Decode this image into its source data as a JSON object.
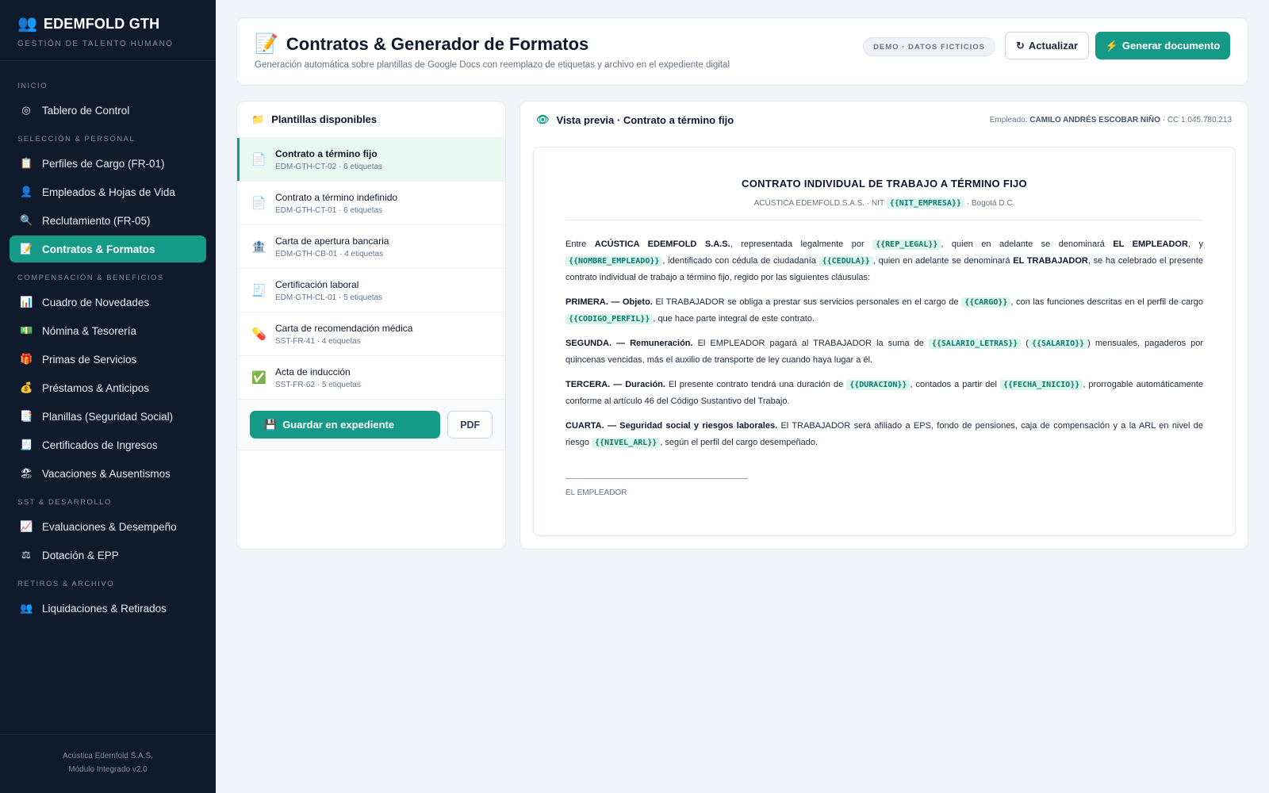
{
  "sidebar": {
    "brand_title": "EDEMFOLD GTH",
    "brand_subtitle": "GESTIÓN DE TALENTO HUMANO",
    "sections": {
      "inicio": "INICIO",
      "seleccion": "SELECCIÓN & PERSONAL",
      "compensacion": "COMPENSACIÓN & BENEFICIOS",
      "sst": "SST & DESARROLLO",
      "retiros": "RETIROS & ARCHIVO"
    },
    "items": {
      "tablero": "Tablero de Control",
      "perfiles": "Perfiles de Cargo (FR-01)",
      "empleados": "Empleados & Hojas de Vida",
      "reclutamiento": "Reclutamiento (FR-05)",
      "contratos": "Contratos & Formatos",
      "novedades": "Cuadro de Novedades",
      "nomina": "Nómina & Tesorería",
      "primas": "Primas de Servicios",
      "prestamos": "Préstamos & Anticipos",
      "planillas": "Planillas (Seguridad Social)",
      "certificados": "Certificados de Ingresos",
      "vacaciones": "Vacaciones & Ausentismos",
      "evaluaciones": "Evaluaciones & Desempeño",
      "dotacion": "Dotación & EPP",
      "liquidaciones": "Liquidaciones & Retirados"
    },
    "footer_line1": "Acústica Edemfold S.A.S.",
    "footer_line2": "Módulo Integrado v2.0"
  },
  "header": {
    "title": "Contratos & Generador de Formatos",
    "subtitle": "Generación automática sobre plantillas de Google Docs con reemplazo de etiquetas y archivo en el expediente digital",
    "badge": "DEMO · DATOS FICTICIOS",
    "refresh_label": "Actualizar",
    "generate_label": "Generar documento"
  },
  "templates": {
    "title": "Plantillas disponibles",
    "items": [
      {
        "name": "Contrato a término fijo",
        "meta": "EDM-GTH-CT-02 · 6 etiquetas",
        "icon": "document-icon"
      },
      {
        "name": "Contrato a término indefinido",
        "meta": "EDM-GTH-CT-01 · 6 etiquetas",
        "icon": "document-icon"
      },
      {
        "name": "Carta de apertura bancaria",
        "meta": "EDM-GTH-CB-01 · 4 etiquetas",
        "icon": "bank-icon"
      },
      {
        "name": "Certificación laboral",
        "meta": "EDM-GTH-CL-01 · 5 etiquetas",
        "icon": "receipt-icon"
      },
      {
        "name": "Carta de recomendación médica",
        "meta": "SST-FR-41 · 4 etiquetas",
        "icon": "pill-icon"
      },
      {
        "name": "Acta de inducción",
        "meta": "SST-FR-62 · 5 etiquetas",
        "icon": "check-icon"
      }
    ],
    "save_label": "Guardar en expediente",
    "pdf_label": "PDF"
  },
  "preview": {
    "title": "Vista previa · Contrato a término fijo",
    "employee_prefix": "Empleado:",
    "employee_name": "CAMILO ANDRÉS ESCOBAR NIÑO",
    "employee_id": "· CC 1.045.780.213",
    "doc": {
      "title": "CONTRATO INDIVIDUAL DE TRABAJO A TÉRMINO FIJO",
      "sub_before": "ACÚSTICA EDEMFOLD S.A.S. · NIT",
      "sub_tag": "{{NIT_EMPRESA}}",
      "sub_after": "· Bogotá D.C.",
      "p1": {
        "t1": "Entre",
        "b1": "ACÚSTICA EDEMFOLD S.A.S.",
        "t2": ", representada legalmente por",
        "tag1": "{{REP_LEGAL}}",
        "t3": ", quien en adelante se denominará",
        "b2": "EL EMPLEADOR",
        "t4": ", y",
        "tag2": "{{NOMBRE_EMPLEADO}}",
        "t5": ", identificado con cédula de ciudadanía",
        "tag3": "{{CEDULA}}",
        "t6": ", quien en adelante se denominará",
        "b3": "EL TRABAJADOR",
        "t7": ", se ha celebrado el presente contrato individual de trabajo a término fijo, regido por las siguientes cláusulas:"
      },
      "p2": {
        "head": "PRIMERA. — Objeto.",
        "t1": "El TRABAJADOR se obliga a prestar sus servicios personales en el cargo de",
        "tag1": "{{CARGO}}",
        "t2": ", con las funciones descritas en el perfil de cargo",
        "tag2": "{{CODIGO_PERFIL}}",
        "t3": ", que hace parte integral de este contrato."
      },
      "p3": {
        "head": "SEGUNDA. — Remuneración.",
        "t1": "El EMPLEADOR pagará al TRABAJADOR la suma de",
        "tag1": "{{SALARIO_LETRAS}}",
        "t2": "(",
        "tag2": "{{SALARIO}}",
        "t3": ") mensuales, pagaderos por quincenas vencidas, más el auxilio de transporte de ley cuando haya lugar a él."
      },
      "p4": {
        "head": "TERCERA. — Duración.",
        "t1": "El presente contrato tendrá una duración de",
        "tag1": "{{DURACION}}",
        "t2": ", contados a partir del",
        "tag2": "{{FECHA_INICIO}}",
        "t3": ", prorrogable automáticamente conforme al artículo 46 del Código Sustantivo del Trabajo."
      },
      "p5": {
        "head": "CUARTA. — Seguridad social y riesgos laborales.",
        "t1": "El TRABAJADOR será afiliado a EPS, fondo de pensiones, caja de compensación y a la ARL en nivel de riesgo",
        "tag1": "{{NIVEL_ARL}}",
        "t2": ", según el perfil del cargo desempeñado."
      },
      "signature": "EL EMPLEADOR"
    }
  },
  "colors": {
    "accent": "#159a87",
    "sidebar_bg": "#0f1b2d",
    "tag_bg": "#d9f5ec",
    "tag_text": "#0f766e"
  }
}
